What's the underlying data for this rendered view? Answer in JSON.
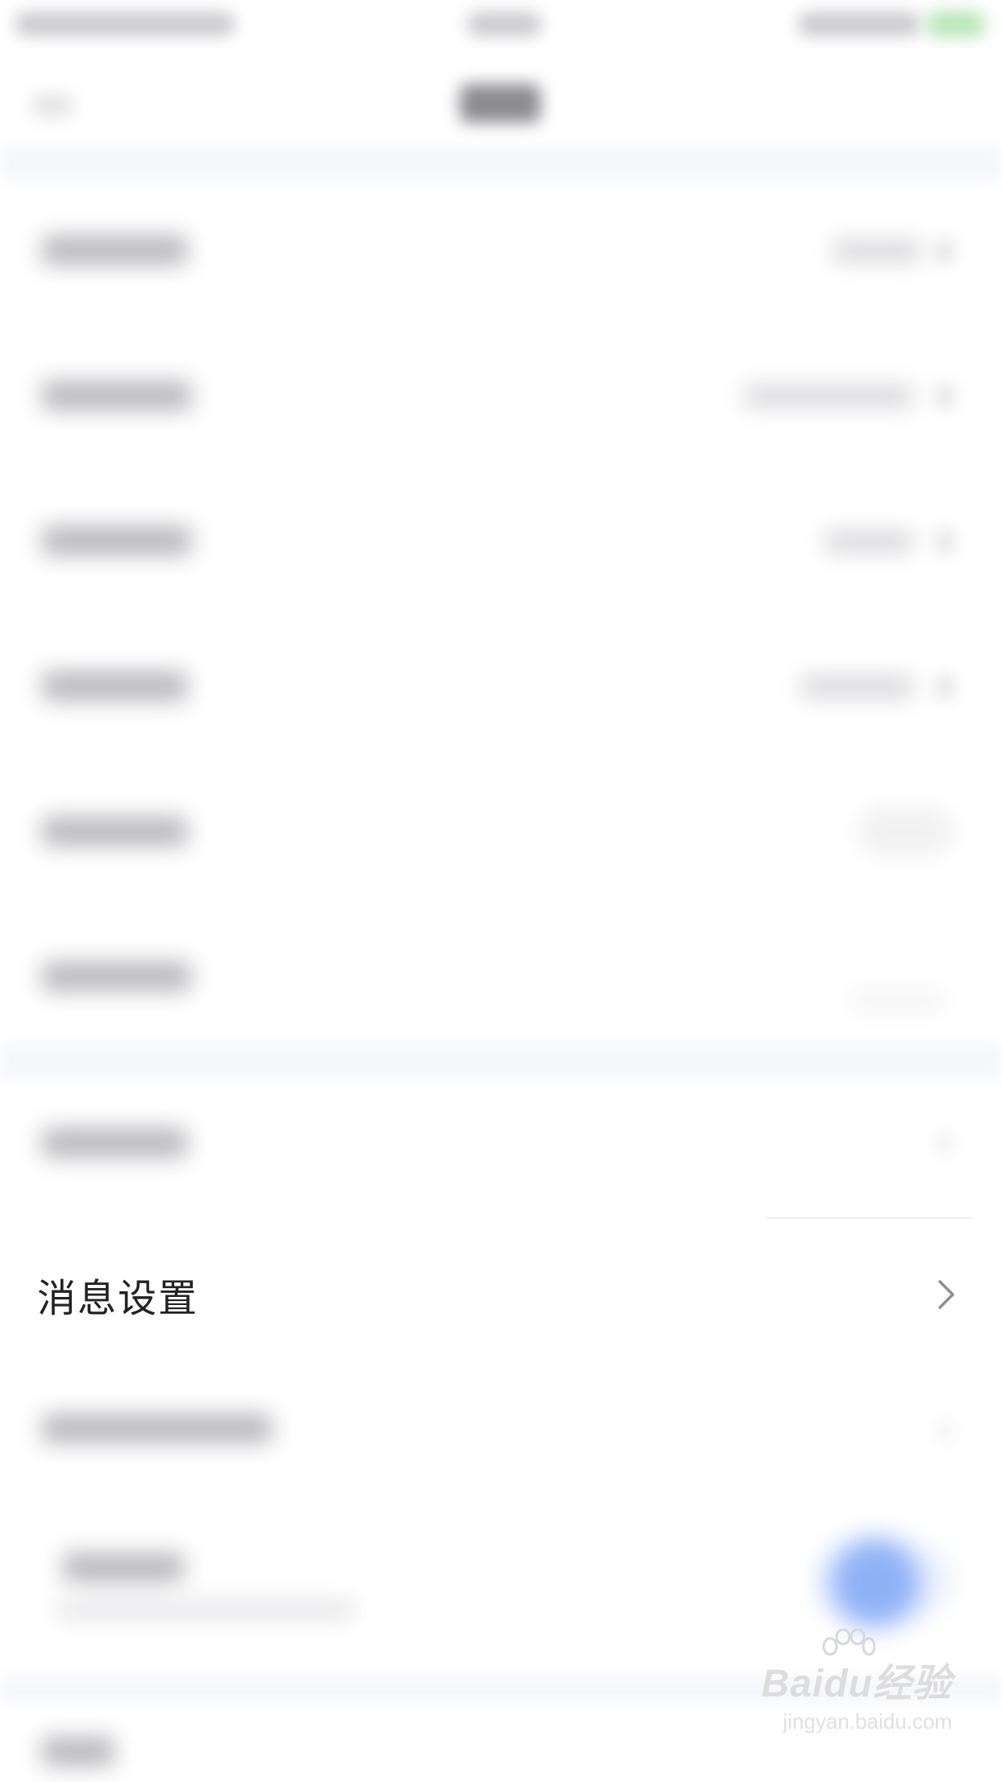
{
  "settings": {
    "message_settings_label": "消息设置"
  },
  "watermark": {
    "brand": "Baidu经验",
    "url": "jingyan.baidu.com"
  },
  "icons": {
    "chevron": "chevron-right-icon",
    "toggle": "toggle-on"
  },
  "colors": {
    "accent_blue": "#6f9cf5",
    "chevron": "#8e8e99",
    "text": "#222222"
  }
}
